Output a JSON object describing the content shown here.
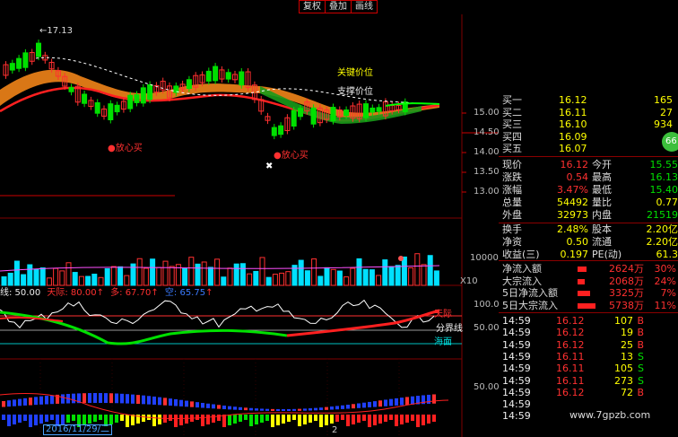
{
  "toolbar": {
    "restore_label": "复权",
    "overlay_label": "叠加",
    "draw_label": "画线"
  },
  "main_chart": {
    "high_marker": "17.13",
    "key_price_label": "关键价位",
    "support_label": "支撑价位",
    "buy_signal_1": "●放心买",
    "buy_signal_2": "●放心买",
    "price_axis": [
      "15.00",
      "14.50",
      "14.00",
      "13.50",
      "13.00"
    ]
  },
  "volume_panel": {
    "axis_label": "10000",
    "multiplier": "X10"
  },
  "indicator_panel": {
    "header_line": "线: 50.00",
    "sky_value": "天际: 80.00",
    "bull_value": "多: 67.70",
    "bear_value": "空: 65.75",
    "axis_top": "100.0",
    "axis_mid": "50.00",
    "label_sky": "天际",
    "label_divide": "分界线",
    "label_sea": "海面"
  },
  "bottom_panel": {
    "axis_label": "50.00",
    "date_label": "2016/11/29/二",
    "tick_label": "2"
  },
  "quote": {
    "bids": [
      {
        "label": "买一",
        "price": "16.12",
        "vol": "165"
      },
      {
        "label": "买二",
        "price": "16.11",
        "vol": "27"
      },
      {
        "label": "买三",
        "price": "16.10",
        "vol": "934"
      },
      {
        "label": "买四",
        "price": "16.09",
        "vol": ""
      },
      {
        "label": "买五",
        "price": "16.07",
        "vol": ""
      }
    ],
    "badge": "66",
    "stats": [
      {
        "l1": "现价",
        "v1": "16.12",
        "l2": "今开",
        "v2": "15.55"
      },
      {
        "l1": "涨跌",
        "v1": "0.54",
        "l2": "最高",
        "v2": "16.13"
      },
      {
        "l1": "涨幅",
        "v1": "3.47%",
        "l2": "最低",
        "v2": "15.40"
      },
      {
        "l1": "总量",
        "v1": "54492",
        "l2": "量比",
        "v2": "0.77"
      },
      {
        "l1": "外盘",
        "v1": "32973",
        "l2": "内盘",
        "v2": "21519"
      }
    ],
    "stats2": [
      {
        "l1": "换手",
        "v1": "2.48%",
        "l2": "股本",
        "v2": "2.20亿"
      },
      {
        "l1": "净资",
        "v1": "0.50",
        "l2": "流通",
        "v2": "2.20亿"
      },
      {
        "l1": "收益(三)",
        "v1": "0.197",
        "l2": "PE(动)",
        "v2": "61.3"
      }
    ],
    "flows": [
      {
        "label": "净流入额",
        "value": "2624万",
        "pct": "30%"
      },
      {
        "label": "大宗流入",
        "value": "2068万",
        "pct": "24%"
      },
      {
        "label": "5日净流入额",
        "value": "3325万",
        "pct": "7%"
      },
      {
        "label": "5日大宗流入",
        "value": "5738万",
        "pct": "11%"
      }
    ],
    "trades": [
      {
        "time": "14:59",
        "price": "16.12",
        "vol": "107",
        "side": "B"
      },
      {
        "time": "14:59",
        "price": "16.12",
        "vol": "19",
        "side": "B"
      },
      {
        "time": "14:59",
        "price": "16.12",
        "vol": "25",
        "side": "B"
      },
      {
        "time": "14:59",
        "price": "16.11",
        "vol": "13",
        "side": "S"
      },
      {
        "time": "14:59",
        "price": "16.11",
        "vol": "105",
        "side": "S"
      },
      {
        "time": "14:59",
        "price": "16.11",
        "vol": "273",
        "side": "S"
      },
      {
        "time": "14:59",
        "price": "16.12",
        "vol": "72",
        "side": "B"
      },
      {
        "time": "14:59",
        "price": "",
        "vol": "",
        "side": ""
      },
      {
        "time": "14:59",
        "price": "",
        "vol": "",
        "side": ""
      }
    ],
    "watermark": "www.7gpzb.com"
  },
  "colors": {
    "up": "#ff3030",
    "down": "#00e000",
    "level": "#ffff00",
    "grid": "#800000"
  }
}
